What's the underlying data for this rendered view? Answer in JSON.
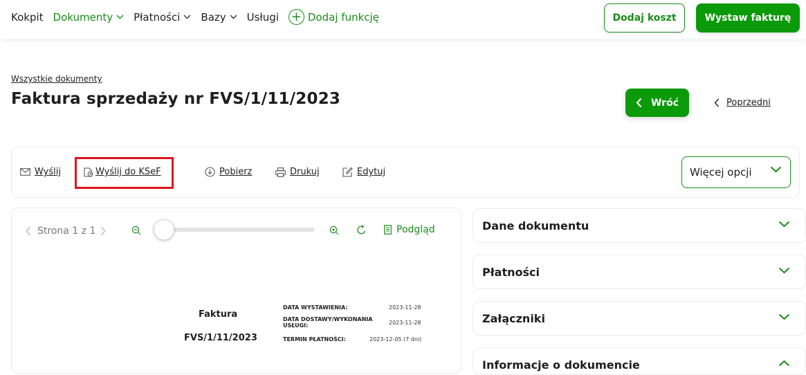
{
  "nav": {
    "items": [
      {
        "label": "Kokpit",
        "active": false,
        "dropdown": false
      },
      {
        "label": "Dokumenty",
        "active": true,
        "dropdown": true
      },
      {
        "label": "Płatności",
        "active": false,
        "dropdown": true
      },
      {
        "label": "Bazy",
        "active": false,
        "dropdown": true
      },
      {
        "label": "Usługi",
        "active": false,
        "dropdown": false
      }
    ],
    "add_function": "Dodaj funkcję"
  },
  "header_buttons": {
    "add_cost": "Dodaj koszt",
    "issue_invoice": "Wystaw fakturę"
  },
  "breadcrumb": "Wszystkie dokumenty",
  "page_title": "Faktura sprzedaży nr FVS/1/11/2023",
  "back_button": "Wróć",
  "previous_link": "Poprzedni",
  "actions": {
    "send": "Wyślij",
    "send_ksef": "Wyślij do KSeF",
    "download": "Pobierz",
    "print": "Drukuj",
    "edit": "Edytuj",
    "more_options": "Więcej opcji"
  },
  "preview": {
    "page_label": "Strona 1 z 1",
    "preview_label": "Podgląd",
    "zoom_level": 0
  },
  "document": {
    "title": "Faktura",
    "number": "FVS/1/11/2023",
    "issue_date_label": "DATA WYSTAWIENIA:",
    "issue_date": "2023-11-28",
    "delivery_date_label_1": "DATA DOSTAWY/WYKONANIA",
    "delivery_date_label_2": "USŁUGI:",
    "delivery_date": "2023-11-28",
    "payment_term_label": "TERMIN PŁATNOŚCI:",
    "payment_term": "2023-12-05 (7 dni)"
  },
  "panels": [
    {
      "title": "Dane dokumentu",
      "expanded": false
    },
    {
      "title": "Płatności",
      "expanded": false
    },
    {
      "title": "Załączniki",
      "expanded": false
    },
    {
      "title": "Informacje o dokumencie",
      "expanded": true
    }
  ],
  "colors": {
    "accent": "#0a9a0a",
    "accent_text": "#1a8c1a",
    "highlight": "#e0141e"
  }
}
